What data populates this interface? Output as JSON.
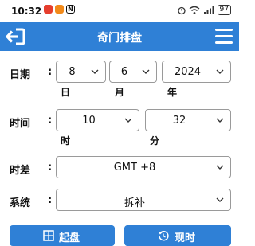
{
  "status": {
    "time": "10:32",
    "battery": "97",
    "icons": [
      "app-notification-icon",
      "app-notification-icon",
      "nfc-icon",
      "alarm-icon",
      "wifi-icon",
      "signal-icon",
      "battery-icon"
    ]
  },
  "appbar": {
    "title": "奇门排盘",
    "left_icon": "exit-icon",
    "right_icon": "menu-icon"
  },
  "form": {
    "date": {
      "label": "日期",
      "colon": ":",
      "day": "8",
      "month": "6",
      "year": "2024",
      "day_unit": "日",
      "month_unit": "月",
      "year_unit": "年"
    },
    "time": {
      "label": "时间",
      "colon": ":",
      "hour": "10",
      "minute": "32",
      "hour_unit": "时",
      "minute_unit": "分"
    },
    "timezone": {
      "label": "时差",
      "colon": ":",
      "value": "GMT +8"
    },
    "system": {
      "label": "系统",
      "colon": ":",
      "value": "拆补"
    }
  },
  "buttons": {
    "start": "起盘",
    "now": "现时"
  },
  "colors": {
    "primary": "#2f80d6"
  }
}
